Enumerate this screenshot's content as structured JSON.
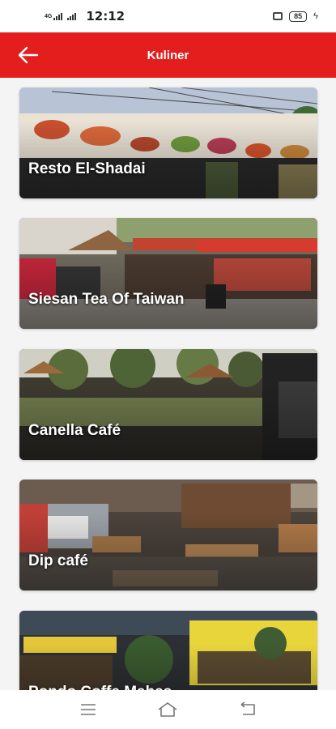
{
  "status_bar": {
    "network": "4G",
    "time": "12:12",
    "battery": "85"
  },
  "app_bar": {
    "title": "Kuliner"
  },
  "places": [
    {
      "name": "Resto El-Shadai"
    },
    {
      "name": "Siesan Tea Of Taiwan"
    },
    {
      "name": "Canella Café"
    },
    {
      "name": "Dip café"
    },
    {
      "name": "Pondo Coffe Mahas"
    }
  ],
  "colors": {
    "accent": "#e41d1d",
    "background": "#f4f4f4"
  },
  "icons": {
    "back": "arrow-left-icon",
    "menu": "recent-apps-icon",
    "home": "home-icon",
    "return": "return-icon"
  }
}
